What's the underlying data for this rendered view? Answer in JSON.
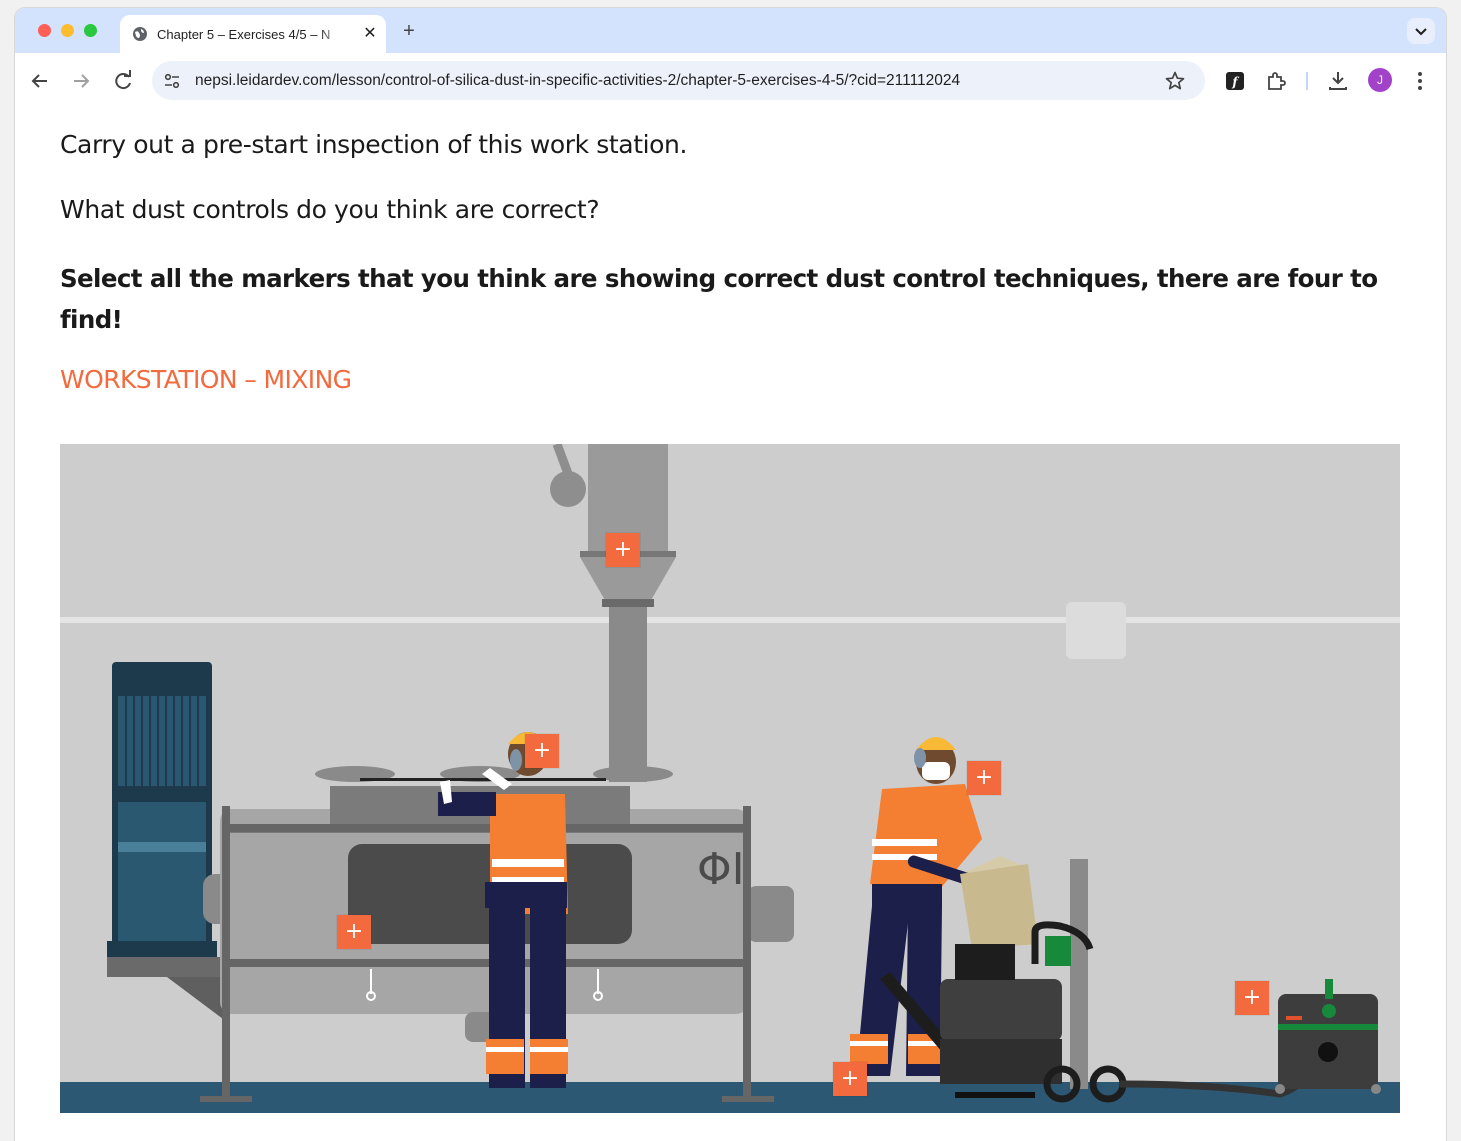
{
  "browser": {
    "tab_title": "Chapter 5 – Exercises 4/5 – N",
    "tab_close": "✕",
    "new_tab": "+",
    "url": "nepsi.leidardev.com/lesson/control-of-silica-dust-in-specific-activities-2/chapter-5-exercises-4-5/?cid=211112024",
    "profile_initial": "J",
    "icons": [
      "globe-icon",
      "close-icon",
      "plus-icon",
      "chevron-down-icon",
      "back-arrow-icon",
      "forward-arrow-icon",
      "reload-icon",
      "site-info-icon",
      "star-icon",
      "extension-f-icon",
      "puzzle-icon",
      "download-icon",
      "kebab-menu-icon"
    ]
  },
  "lesson": {
    "intro": "Carry out a pre-start inspection of this work station.",
    "question": "What dust controls do you think are correct?",
    "instruction": "Select all the markers that you think are showing correct dust control techniques, there are four to find!",
    "heading": "WORKSTATION – MIXING",
    "heading_color": "#f26a3d"
  },
  "markers": [
    {
      "label": "+"
    },
    {
      "label": "+"
    },
    {
      "label": "+"
    },
    {
      "label": "+"
    },
    {
      "label": "+"
    },
    {
      "label": "+"
    }
  ]
}
